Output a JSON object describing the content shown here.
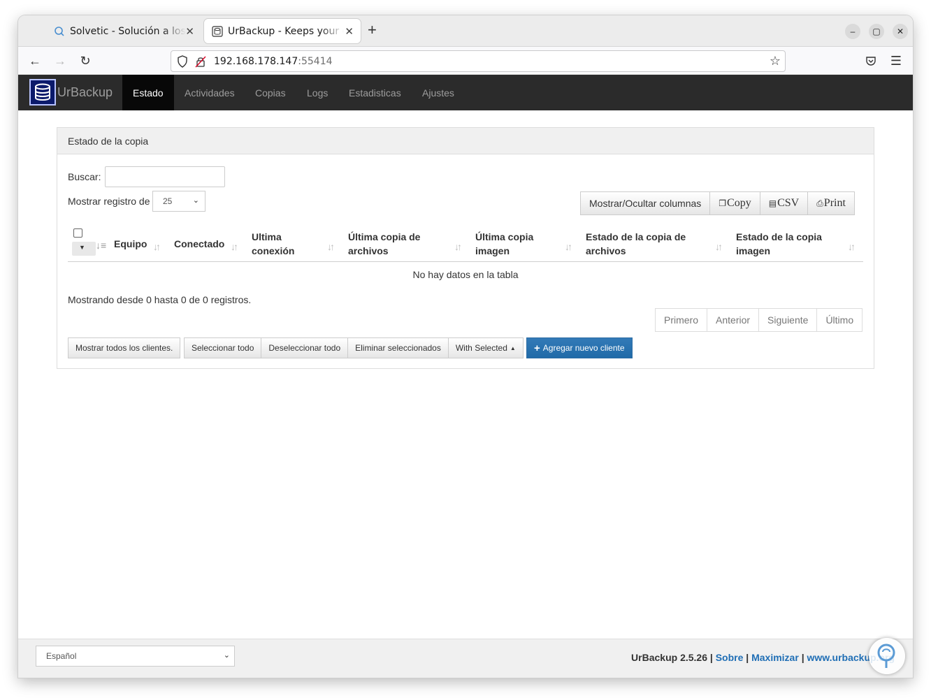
{
  "browser": {
    "tabs": [
      {
        "title": "Solvetic - Solución a los problemas",
        "active": false,
        "icon": "solvetic-favicon"
      },
      {
        "title": "UrBackup - Keeps your data safe",
        "active": true,
        "icon": "database-icon"
      }
    ],
    "url_host": "192.168.178.147",
    "url_port": ":55414"
  },
  "app": {
    "brand": "UrBackup",
    "nav": [
      "Estado",
      "Actividades",
      "Copias",
      "Logs",
      "Estadisticas",
      "Ajustes"
    ],
    "active_nav": "Estado",
    "colors": {
      "header_bg": "#2b2b2b",
      "primary": "#337ab7",
      "link": "#1f6eb5"
    }
  },
  "panel": {
    "title": "Estado de la copia",
    "search_label": "Buscar:",
    "search_value": "",
    "length_label": "Mostrar registro de",
    "length_value": "25",
    "toolbar": {
      "columns": "Mostrar/Ocultar columnas",
      "copy": "Copy",
      "csv": "CSV",
      "print": "Print"
    },
    "columns": [
      "Equipo",
      "Conectado",
      "Ultima conexión",
      "Última copia de archivos",
      "Última copia imagen",
      "Estado de la copia de archivos",
      "Estado de la copia imagen"
    ],
    "empty": "No hay datos en la tabla",
    "info": "Mostrando desde 0 hasta 0 de 0 registros.",
    "pager": [
      "Primero",
      "Anterior",
      "Siguiente",
      "Último"
    ],
    "actions": {
      "show_all": "Mostrar todos los clientes.",
      "select_all": "Seleccionar todo",
      "deselect_all": "Deseleccionar todo",
      "delete_selected": "Eliminar seleccionados",
      "with_selected": "With Selected",
      "add_client": "Agregar nuevo cliente"
    }
  },
  "footer": {
    "language": "Español",
    "version": "UrBackup 2.5.26",
    "links": [
      "Sobre",
      "Maximizar",
      "www.urbackup.org"
    ]
  }
}
